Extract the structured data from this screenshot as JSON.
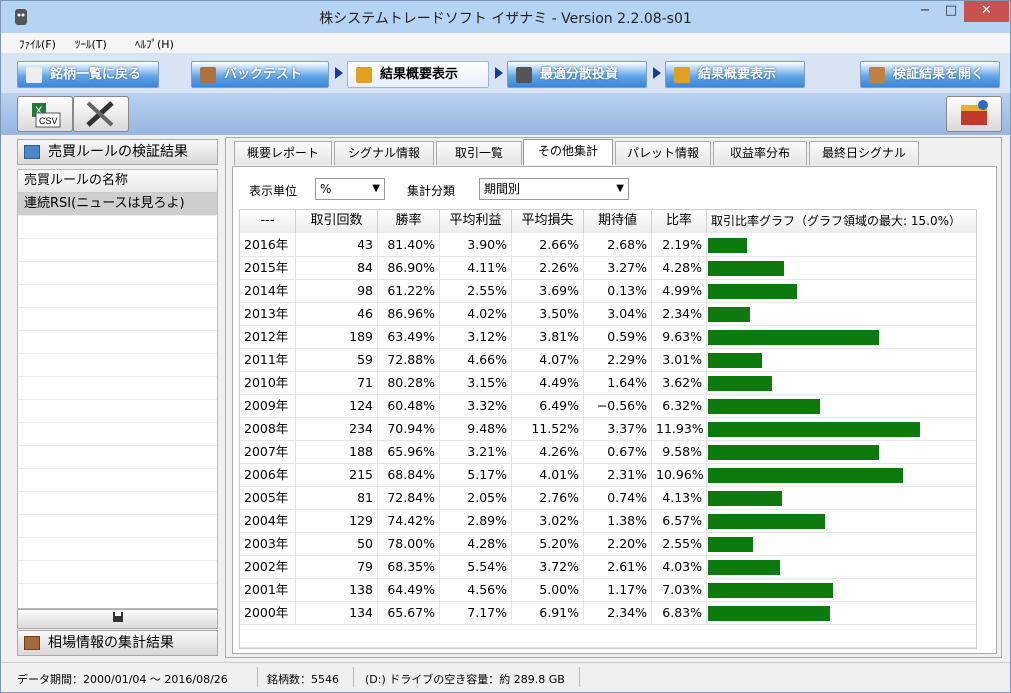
{
  "window": {
    "title": "株システムトレードソフト イザナミ - Version 2.2.08-s01",
    "min": "−",
    "max": "□",
    "close": "✕"
  },
  "menu": [
    {
      "label": "ﾌｧｲﾙ(F)"
    },
    {
      "label": "ﾂｰﾙ(T)"
    },
    {
      "label": "ﾍﾙﾌﾟ(H)"
    }
  ],
  "nav": {
    "tabs": [
      "銘柄一覧に戻る",
      "バックテスト",
      "結果概要表示",
      "最適分散投資",
      "結果概要表示",
      "検証結果を開く"
    ]
  },
  "toolbar": {
    "csv_label": "CSV"
  },
  "left": {
    "header": "売買ルールの検証結果",
    "col_header": "売買ルールの名称",
    "rules": [
      "連続RSI(ニュースは見ろよ)"
    ],
    "footer": "相場情報の集計結果"
  },
  "subtabs": [
    "概要レポート",
    "シグナル情報",
    "取引一覧",
    "その他集計",
    "パレット情報",
    "収益率分布",
    "最終日シグナル"
  ],
  "filters": {
    "unit_label": "表示単位",
    "unit_value": "%",
    "group_label": "集計分類",
    "group_value": "期間別"
  },
  "table": {
    "headers": [
      "---",
      "取引回数",
      "勝率",
      "平均利益",
      "平均損失",
      "期待値",
      "比率",
      "取引比率グラフ（グラフ領域の最大: 15.0%）"
    ],
    "graph_max_pct": 15.0,
    "rows": [
      {
        "year": "2016年",
        "count": "43",
        "win": "81.40%",
        "avg_profit": "3.90%",
        "avg_loss": "2.66%",
        "expect": "2.68%",
        "ratio": "2.19%",
        "ratio_value": 2.19
      },
      {
        "year": "2015年",
        "count": "84",
        "win": "86.90%",
        "avg_profit": "4.11%",
        "avg_loss": "2.26%",
        "expect": "3.27%",
        "ratio": "4.28%",
        "ratio_value": 4.28
      },
      {
        "year": "2014年",
        "count": "98",
        "win": "61.22%",
        "avg_profit": "2.55%",
        "avg_loss": "3.69%",
        "expect": "0.13%",
        "ratio": "4.99%",
        "ratio_value": 4.99
      },
      {
        "year": "2013年",
        "count": "46",
        "win": "86.96%",
        "avg_profit": "4.02%",
        "avg_loss": "3.50%",
        "expect": "3.04%",
        "ratio": "2.34%",
        "ratio_value": 2.34
      },
      {
        "year": "2012年",
        "count": "189",
        "win": "63.49%",
        "avg_profit": "3.12%",
        "avg_loss": "3.81%",
        "expect": "0.59%",
        "ratio": "9.63%",
        "ratio_value": 9.63
      },
      {
        "year": "2011年",
        "count": "59",
        "win": "72.88%",
        "avg_profit": "4.66%",
        "avg_loss": "4.07%",
        "expect": "2.29%",
        "ratio": "3.01%",
        "ratio_value": 3.01
      },
      {
        "year": "2010年",
        "count": "71",
        "win": "80.28%",
        "avg_profit": "3.15%",
        "avg_loss": "4.49%",
        "expect": "1.64%",
        "ratio": "3.62%",
        "ratio_value": 3.62
      },
      {
        "year": "2009年",
        "count": "124",
        "win": "60.48%",
        "avg_profit": "3.32%",
        "avg_loss": "6.49%",
        "expect": "−0.56%",
        "ratio": "6.32%",
        "ratio_value": 6.32
      },
      {
        "year": "2008年",
        "count": "234",
        "win": "70.94%",
        "avg_profit": "9.48%",
        "avg_loss": "11.52%",
        "expect": "3.37%",
        "ratio": "11.93%",
        "ratio_value": 11.93
      },
      {
        "year": "2007年",
        "count": "188",
        "win": "65.96%",
        "avg_profit": "3.21%",
        "avg_loss": "4.26%",
        "expect": "0.67%",
        "ratio": "9.58%",
        "ratio_value": 9.58
      },
      {
        "year": "2006年",
        "count": "215",
        "win": "68.84%",
        "avg_profit": "5.17%",
        "avg_loss": "4.01%",
        "expect": "2.31%",
        "ratio": "10.96%",
        "ratio_value": 10.96
      },
      {
        "year": "2005年",
        "count": "81",
        "win": "72.84%",
        "avg_profit": "2.05%",
        "avg_loss": "2.76%",
        "expect": "0.74%",
        "ratio": "4.13%",
        "ratio_value": 4.13
      },
      {
        "year": "2004年",
        "count": "129",
        "win": "74.42%",
        "avg_profit": "2.89%",
        "avg_loss": "3.02%",
        "expect": "1.38%",
        "ratio": "6.57%",
        "ratio_value": 6.57
      },
      {
        "year": "2003年",
        "count": "50",
        "win": "78.00%",
        "avg_profit": "4.28%",
        "avg_loss": "5.20%",
        "expect": "2.20%",
        "ratio": "2.55%",
        "ratio_value": 2.55
      },
      {
        "year": "2002年",
        "count": "79",
        "win": "68.35%",
        "avg_profit": "5.54%",
        "avg_loss": "3.72%",
        "expect": "2.61%",
        "ratio": "4.03%",
        "ratio_value": 4.03
      },
      {
        "year": "2001年",
        "count": "138",
        "win": "64.49%",
        "avg_profit": "4.56%",
        "avg_loss": "5.00%",
        "expect": "1.17%",
        "ratio": "7.03%",
        "ratio_value": 7.03
      },
      {
        "year": "2000年",
        "count": "134",
        "win": "65.67%",
        "avg_profit": "7.17%",
        "avg_loss": "6.91%",
        "expect": "2.34%",
        "ratio": "6.83%",
        "ratio_value": 6.83
      }
    ]
  },
  "status": {
    "period": "データ期間：2000/01/04 〜 2016/08/26",
    "stocks": "銘柄数：5546",
    "drive": "(D:) ドライブの空き容量：約 289.8 GB"
  },
  "colors": {
    "bar": "#0c7a0c",
    "accent": "#3a86d8"
  }
}
